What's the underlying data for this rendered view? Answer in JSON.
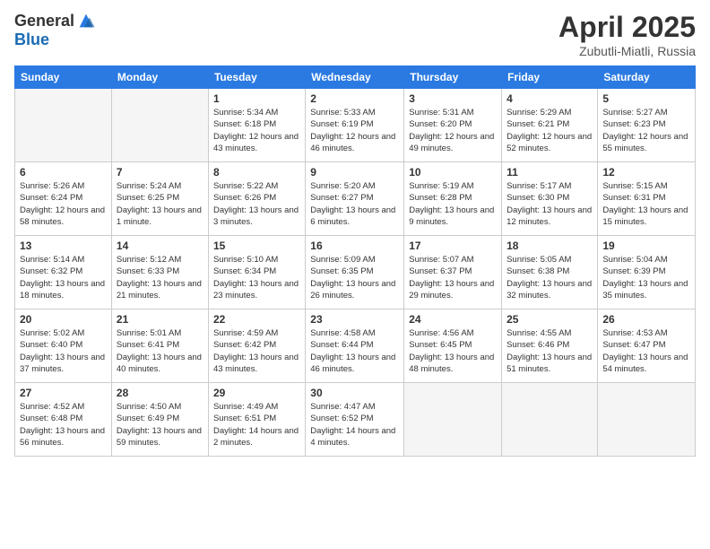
{
  "header": {
    "logo_general": "General",
    "logo_blue": "Blue",
    "month_title": "April 2025",
    "subtitle": "Zubutli-Miatli, Russia"
  },
  "days_of_week": [
    "Sunday",
    "Monday",
    "Tuesday",
    "Wednesday",
    "Thursday",
    "Friday",
    "Saturday"
  ],
  "weeks": [
    [
      {
        "day": "",
        "info": ""
      },
      {
        "day": "",
        "info": ""
      },
      {
        "day": "1",
        "info": "Sunrise: 5:34 AM\nSunset: 6:18 PM\nDaylight: 12 hours and 43 minutes."
      },
      {
        "day": "2",
        "info": "Sunrise: 5:33 AM\nSunset: 6:19 PM\nDaylight: 12 hours and 46 minutes."
      },
      {
        "day": "3",
        "info": "Sunrise: 5:31 AM\nSunset: 6:20 PM\nDaylight: 12 hours and 49 minutes."
      },
      {
        "day": "4",
        "info": "Sunrise: 5:29 AM\nSunset: 6:21 PM\nDaylight: 12 hours and 52 minutes."
      },
      {
        "day": "5",
        "info": "Sunrise: 5:27 AM\nSunset: 6:23 PM\nDaylight: 12 hours and 55 minutes."
      }
    ],
    [
      {
        "day": "6",
        "info": "Sunrise: 5:26 AM\nSunset: 6:24 PM\nDaylight: 12 hours and 58 minutes."
      },
      {
        "day": "7",
        "info": "Sunrise: 5:24 AM\nSunset: 6:25 PM\nDaylight: 13 hours and 1 minute."
      },
      {
        "day": "8",
        "info": "Sunrise: 5:22 AM\nSunset: 6:26 PM\nDaylight: 13 hours and 3 minutes."
      },
      {
        "day": "9",
        "info": "Sunrise: 5:20 AM\nSunset: 6:27 PM\nDaylight: 13 hours and 6 minutes."
      },
      {
        "day": "10",
        "info": "Sunrise: 5:19 AM\nSunset: 6:28 PM\nDaylight: 13 hours and 9 minutes."
      },
      {
        "day": "11",
        "info": "Sunrise: 5:17 AM\nSunset: 6:30 PM\nDaylight: 13 hours and 12 minutes."
      },
      {
        "day": "12",
        "info": "Sunrise: 5:15 AM\nSunset: 6:31 PM\nDaylight: 13 hours and 15 minutes."
      }
    ],
    [
      {
        "day": "13",
        "info": "Sunrise: 5:14 AM\nSunset: 6:32 PM\nDaylight: 13 hours and 18 minutes."
      },
      {
        "day": "14",
        "info": "Sunrise: 5:12 AM\nSunset: 6:33 PM\nDaylight: 13 hours and 21 minutes."
      },
      {
        "day": "15",
        "info": "Sunrise: 5:10 AM\nSunset: 6:34 PM\nDaylight: 13 hours and 23 minutes."
      },
      {
        "day": "16",
        "info": "Sunrise: 5:09 AM\nSunset: 6:35 PM\nDaylight: 13 hours and 26 minutes."
      },
      {
        "day": "17",
        "info": "Sunrise: 5:07 AM\nSunset: 6:37 PM\nDaylight: 13 hours and 29 minutes."
      },
      {
        "day": "18",
        "info": "Sunrise: 5:05 AM\nSunset: 6:38 PM\nDaylight: 13 hours and 32 minutes."
      },
      {
        "day": "19",
        "info": "Sunrise: 5:04 AM\nSunset: 6:39 PM\nDaylight: 13 hours and 35 minutes."
      }
    ],
    [
      {
        "day": "20",
        "info": "Sunrise: 5:02 AM\nSunset: 6:40 PM\nDaylight: 13 hours and 37 minutes."
      },
      {
        "day": "21",
        "info": "Sunrise: 5:01 AM\nSunset: 6:41 PM\nDaylight: 13 hours and 40 minutes."
      },
      {
        "day": "22",
        "info": "Sunrise: 4:59 AM\nSunset: 6:42 PM\nDaylight: 13 hours and 43 minutes."
      },
      {
        "day": "23",
        "info": "Sunrise: 4:58 AM\nSunset: 6:44 PM\nDaylight: 13 hours and 46 minutes."
      },
      {
        "day": "24",
        "info": "Sunrise: 4:56 AM\nSunset: 6:45 PM\nDaylight: 13 hours and 48 minutes."
      },
      {
        "day": "25",
        "info": "Sunrise: 4:55 AM\nSunset: 6:46 PM\nDaylight: 13 hours and 51 minutes."
      },
      {
        "day": "26",
        "info": "Sunrise: 4:53 AM\nSunset: 6:47 PM\nDaylight: 13 hours and 54 minutes."
      }
    ],
    [
      {
        "day": "27",
        "info": "Sunrise: 4:52 AM\nSunset: 6:48 PM\nDaylight: 13 hours and 56 minutes."
      },
      {
        "day": "28",
        "info": "Sunrise: 4:50 AM\nSunset: 6:49 PM\nDaylight: 13 hours and 59 minutes."
      },
      {
        "day": "29",
        "info": "Sunrise: 4:49 AM\nSunset: 6:51 PM\nDaylight: 14 hours and 2 minutes."
      },
      {
        "day": "30",
        "info": "Sunrise: 4:47 AM\nSunset: 6:52 PM\nDaylight: 14 hours and 4 minutes."
      },
      {
        "day": "",
        "info": ""
      },
      {
        "day": "",
        "info": ""
      },
      {
        "day": "",
        "info": ""
      }
    ]
  ]
}
